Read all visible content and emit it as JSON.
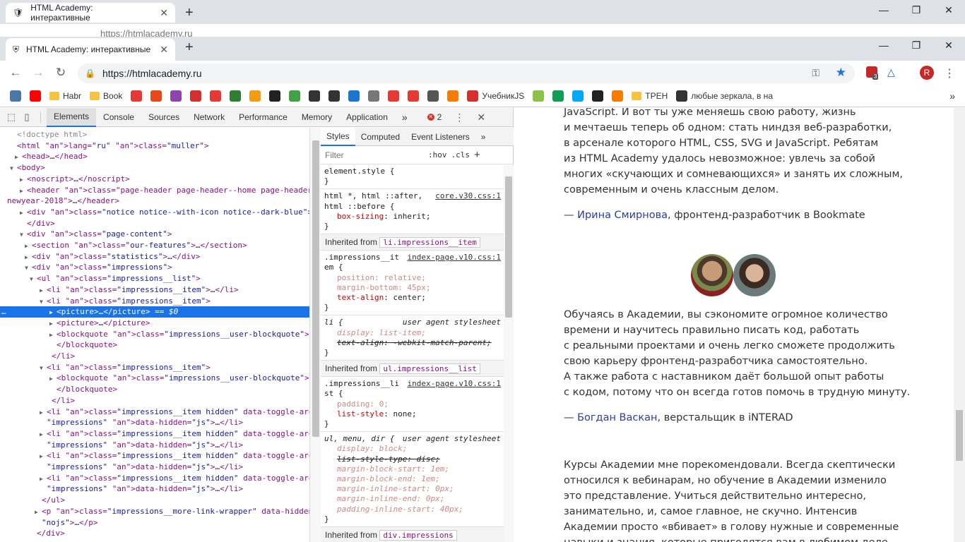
{
  "browser": {
    "tab_title": "HTML Academy: интерактивные",
    "ghost_tab_title": "HTML Academy: интерактивные",
    "ghost_url": "https://htmlacademy.ru",
    "url": "https://htmlacademy.ru",
    "profile_initial": "R",
    "ext_badge": "3",
    "new_tab_symbol": "+",
    "close_symbol": "✕",
    "window_controls": [
      "—",
      "❐",
      "✕"
    ]
  },
  "bookmarks": [
    {
      "label": "",
      "icon": "vk-icon",
      "color": "#4a76a8"
    },
    {
      "label": "",
      "icon": "youtube-icon",
      "color": "#ff0000"
    },
    {
      "label": "Habr",
      "icon": "folder-icon",
      "color": "#f5c542"
    },
    {
      "label": "Book",
      "icon": "folder-icon",
      "color": "#f5c542"
    },
    {
      "label": "",
      "icon": "tv-icon",
      "color": "#e53935"
    },
    {
      "label": "",
      "icon": "ext-icon",
      "color": "#e64a19"
    },
    {
      "label": "",
      "icon": "flower-icon",
      "color": "#8e44ad"
    },
    {
      "label": "",
      "icon": "star-icon",
      "color": "#d32f2f"
    },
    {
      "label": "",
      "icon": "lf-icon",
      "color": "#e53935"
    },
    {
      "label": "",
      "icon": "leaf-icon",
      "color": "#2e7d32"
    },
    {
      "label": "",
      "icon": "color-icon",
      "color": "#f39c12"
    },
    {
      "label": "",
      "icon": "bs-icon",
      "color": "#222222"
    },
    {
      "label": "",
      "icon": "two-icon",
      "color": "#43a047"
    },
    {
      "label": "",
      "icon": "people-icon",
      "color": "#333333"
    },
    {
      "label": "",
      "icon": "bars-icon",
      "color": "#333333"
    },
    {
      "label": "",
      "icon": "box-icon",
      "color": "#1976d2"
    },
    {
      "label": "",
      "icon": "doc-icon",
      "color": "#777777"
    },
    {
      "label": "",
      "icon": "gear-icon",
      "color": "#e53935"
    },
    {
      "label": "",
      "icon": "chart-icon",
      "color": "#e53935"
    },
    {
      "label": "",
      "icon": "shield-icon",
      "color": "#555555"
    },
    {
      "label": "",
      "icon": "orange-icon",
      "color": "#f57c00"
    },
    {
      "label": "УчебникJS",
      "icon": "js-icon",
      "color": "#d32f2f"
    },
    {
      "label": "",
      "icon": "grid-icon",
      "color": "#8bc34a"
    },
    {
      "label": "",
      "icon": "sheet-icon",
      "color": "#0f9d58"
    },
    {
      "label": "",
      "icon": "bird-icon",
      "color": "#03a9f4"
    },
    {
      "label": "",
      "icon": "home-icon",
      "color": "#222222"
    },
    {
      "label": "",
      "icon": "py-icon",
      "color": "#f57c00"
    },
    {
      "label": "ТРЕН",
      "icon": "folder-icon",
      "color": "#f5c542"
    },
    {
      "label": "любые зеркала, в на",
      "icon": "people-icon",
      "color": "#333333"
    }
  ],
  "devtools": {
    "tabs": [
      "Elements",
      "Console",
      "Sources",
      "Network",
      "Performance",
      "Memory",
      "Application"
    ],
    "active_tab": "Elements",
    "more": "»",
    "error_count": "2",
    "styles_tabs": [
      "Styles",
      "Computed",
      "Event Listeners"
    ],
    "styles_more": "»",
    "filter_placeholder": "Filter",
    "hov": ":hov",
    "cls": ".cls",
    "add": "+",
    "dom_lines": [
      "<!doctype html>",
      "<html lang=\"ru\" class=\"muller\">",
      "<head>…</head>",
      "<body>",
      "<noscript>…</noscript>",
      "<header class=\"page-header page-header--home page-header--",
      "newyear-2018\">…</header>",
      "<div class=\"notice notice--with-icon notice--dark-blue\">…",
      "</div>",
      "<div class=\"page-content\">",
      "<section class=\"our-features\">…</section>",
      "<div class=\"statistics\">…</div>",
      "<div class=\"impressions\">",
      "<ul class=\"impressions__list\">",
      "<li class=\"impressions__item\">…</li>",
      "<li class=\"impressions__item\">",
      "<picture>…</picture> == $0",
      "<picture>…</picture>",
      "<blockquote class=\"impressions__user-blockquote\">…",
      "</blockquote>",
      "</li>",
      "<li class=\"impressions__item\">",
      "<blockquote class=\"impressions__user-blockquote\">…",
      "</blockquote>",
      "</li>",
      "<li class=\"impressions__item hidden\" data-toggle-area=",
      "\"impressions\" data-hidden=\"js\">…</li>",
      "<li class=\"impressions__item hidden\" data-toggle-area=",
      "\"impressions\" data-hidden=\"js\">…</li>",
      "<li class=\"impressions__item hidden\" data-toggle-area=",
      "\"impressions\" data-hidden=\"js\">…</li>",
      "<li class=\"impressions__item hidden\" data-toggle-area=",
      "\"impressions\" data-hidden=\"js\">…</li>",
      "</ul>",
      "<p class=\"impressions__more-link-wrapper\" data-hidden=",
      "\"nojs\">…</p>",
      "</div>"
    ],
    "styles": {
      "element_style": "element.style {",
      "rule1_sel1": "html *, html ::after,",
      "rule1_sel2": "html ::before {",
      "rule1_src": "core.v30.css:1",
      "rule1_decl": [
        "box-sizing",
        "inherit;"
      ],
      "inherited1": "Inherited from",
      "inherited1_code": "li.impressions__item",
      "rule2_sel1": ".impressions__it",
      "rule2_sel2": "em {",
      "rule2_src": "index-page.v10.css:1",
      "rule2_decls": [
        [
          "position",
          "relative;"
        ],
        [
          "margin-bottom",
          "45px;"
        ],
        [
          "text-align",
          "center;"
        ]
      ],
      "rule3_sel": "li {",
      "rule3_ua": "user agent stylesheet",
      "rule3_decls": [
        [
          "display",
          "list-item;"
        ],
        [
          "text-align",
          "-webkit-match-parent;"
        ]
      ],
      "inherited2": "Inherited from",
      "inherited2_code": "ul.impressions__list",
      "rule4_sel1": ".impressions__li",
      "rule4_sel2": "st {",
      "rule4_src": "index-page.v10.css:1",
      "rule4_decls": [
        [
          "padding",
          "0;"
        ],
        [
          "list-style",
          "none;"
        ]
      ],
      "rule5_sel": "ul, menu, dir {",
      "rule5_ua": "user agent stylesheet",
      "rule5_decls": [
        [
          "display",
          "block;"
        ],
        [
          "list-style-type",
          "disc;"
        ],
        [
          "margin-block-start",
          "1em;"
        ],
        [
          "margin-block-end",
          "1em;"
        ],
        [
          "margin-inline-start",
          "0px;"
        ],
        [
          "margin-inline-end",
          "0px;"
        ],
        [
          "padding-inline-start",
          "40px;"
        ]
      ],
      "inherited3": "Inherited from",
      "inherited3_code": "div.impressions",
      "close_brace": "}",
      "sep": ": "
    }
  },
  "page": {
    "quote1": [
      "JavaScript. И вот ты уже меняешь свою работу, жизнь",
      "и мечтаешь теперь об одном: стать ниндзя веб-разработки,",
      "в арсенале которого HTML, CSS, SVG и JavaScript. Ребятам",
      "из HTML Academy удалось невозможное: увлечь за собой",
      "многих «скучающих и сомневающихся» и занять их сложным,",
      "современным и очень классным делом."
    ],
    "author1_dash": "— ",
    "author1_name": "Ирина Смирнова",
    "author1_role": ", фронтенд-разработчик в Bookmate",
    "quote2": [
      "Обучаясь в Академии, вы сэкономите огромное количество",
      "времени и научитесь правильно писать код, работать",
      "с реальными проектами и очень легко сможете продолжить",
      "свою карьеру фронтенд-разработчика самостоятельно.",
      "А также работа с наставником даёт большой опыт работы",
      "с кодом, потому что он всегда готов помочь в трудную минуту."
    ],
    "author2_dash": "— ",
    "author2_name": "Богдан Васкан",
    "author2_role": ", верстальщик в iNTERAD",
    "quote3": [
      "Курсы Академии мне порекомендовали. Всегда скептически",
      "относился к вебинарам, но обучение в Академии изменило",
      "это представление. Учиться действительно интересно,",
      "занимательно, и, самое главное, не скучно. Интенсив",
      "Академии просто «вбивает» в голову нужные и современные",
      "навыки и знания, которые пригодятся вам в любимом деле."
    ]
  }
}
